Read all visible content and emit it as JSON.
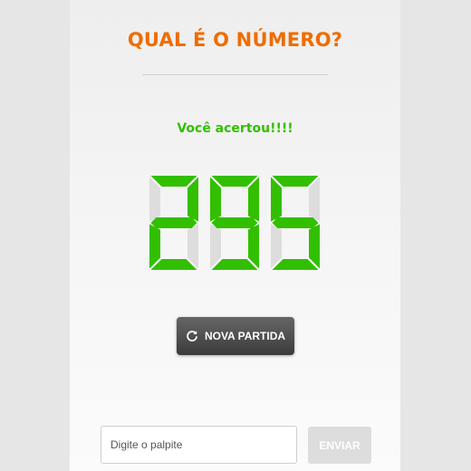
{
  "game": {
    "title": "QUAL É O NÚMERO?",
    "status_message": "Você acertou!!!!",
    "display_number": "295"
  },
  "controls": {
    "restart_label": "NOVA PARTIDA",
    "restart_icon": "refresh-icon",
    "input_placeholder": "Digite o palpite",
    "input_value": "",
    "send_label": "ENVIAR",
    "send_enabled": false
  },
  "colors": {
    "title": "#ef6c00",
    "success": "#32bf00",
    "segment_off": "#dddddd",
    "button_dark": "#4a4a4a",
    "button_disabled": "#dddddd"
  }
}
